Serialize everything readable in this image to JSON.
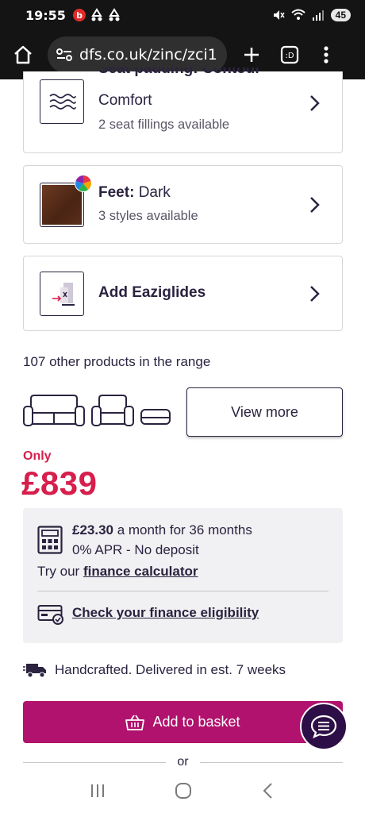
{
  "status": {
    "time": "19:55",
    "battery": "45"
  },
  "browser": {
    "url": "dfs.co.uk/zinc/zci1"
  },
  "cards": [
    {
      "title_top": "Seat padding: Contour",
      "title": "Comfort",
      "sub": "2 seat fillings available",
      "icon": "waves-icon"
    },
    {
      "label": "Feet:",
      "value": "Dark",
      "sub": "3 styles available",
      "icon": "wood-swatch",
      "swatch_color": "#5a2e1c"
    },
    {
      "title": "Add Eaziglides",
      "icon": "eaziglides-icon"
    }
  ],
  "range": {
    "text": "107 other products in the range",
    "view_more": "View more"
  },
  "price": {
    "only": "Only",
    "amount": "£839"
  },
  "finance": {
    "monthly": "£23.30",
    "monthly_rest": " a month for 36 months",
    "apr": "0% APR - No deposit",
    "try_prefix": "Try our ",
    "calc_link": "finance calculator",
    "eligibility": "Check your finance eligibility"
  },
  "delivery": {
    "text": "Handcrafted. Delivered in est. 7 weeks"
  },
  "basket": {
    "label": "Add to basket"
  },
  "or_label": "or",
  "colors": {
    "accent": "#d61f4c",
    "button": "#b0126d",
    "chat": "#2e0e46",
    "text": "#2b2340"
  }
}
